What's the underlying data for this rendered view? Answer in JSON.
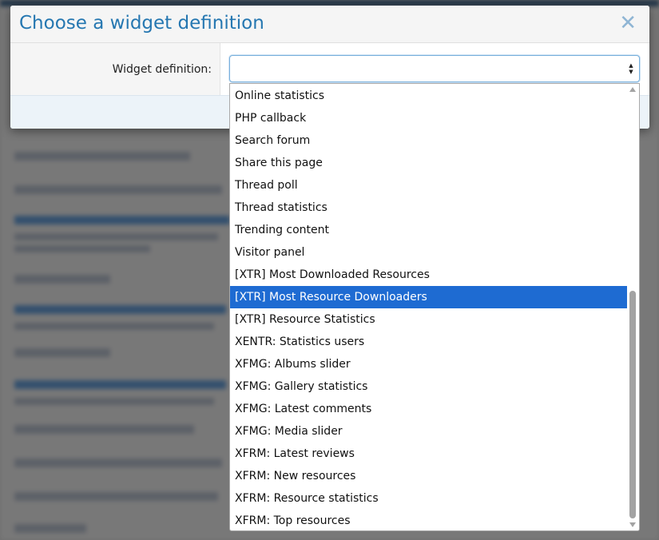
{
  "dialog": {
    "title": "Choose a widget definition",
    "close_glyph": "✕",
    "field_label": "Widget definition:",
    "select_value": ""
  },
  "dropdown": {
    "items": [
      "Online statistics",
      "PHP callback",
      "Search forum",
      "Share this page",
      "Thread poll",
      "Thread statistics",
      "Trending content",
      "Visitor panel",
      "[XTR] Most Downloaded Resources",
      "[XTR] Most Resource Downloaders",
      "[XTR] Resource Statistics",
      "XENTR: Statistics users",
      "XFMG: Albums slider",
      "XFMG: Gallery statistics",
      "XFMG: Latest comments",
      "XFMG: Media slider",
      "XFRM: Latest reviews",
      "XFRM: New resources",
      "XFRM: Resource statistics",
      "XFRM: Top resources"
    ],
    "selected_index": 9
  },
  "colors": {
    "title": "#2577b1",
    "selected_bg": "#1e6bd2",
    "select_border": "#79b0dc"
  },
  "icons": {
    "close": "close-icon",
    "select_arrows": "select-arrows-icon",
    "scroll_up": "scroll-up-arrow-icon",
    "scroll_down": "scroll-down-arrow-icon"
  }
}
